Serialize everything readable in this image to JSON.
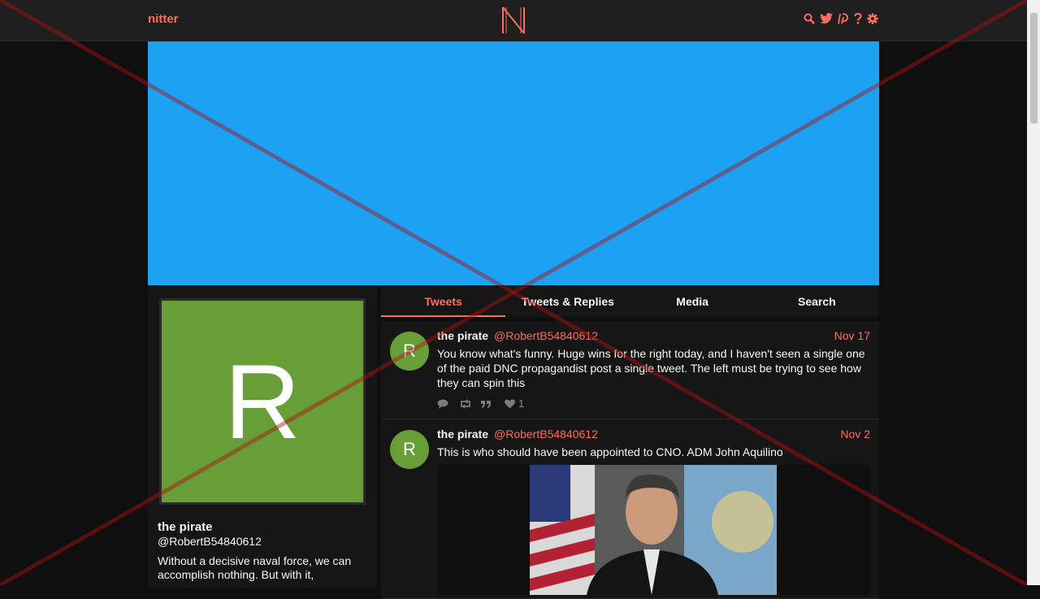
{
  "nav": {
    "brand": "nitter",
    "icons": [
      "search-icon",
      "twitter-icon",
      "rss-icon",
      "help-icon",
      "settings-icon"
    ]
  },
  "colors": {
    "accent": "#ff6c60",
    "banner": "#1da1f2",
    "avatar": "#679e37",
    "background": "#0f0f0f",
    "panel": "#161616"
  },
  "profile": {
    "avatar_letter": "R",
    "fullname": "the pirate",
    "username": "@RobertB54840612",
    "bio": "Without a decisive naval force, we can accomplish nothing. But with it,"
  },
  "tabs": [
    {
      "label": "Tweets",
      "active": true
    },
    {
      "label": "Tweets & Replies",
      "active": false
    },
    {
      "label": "Media",
      "active": false
    },
    {
      "label": "Search",
      "active": false
    }
  ],
  "tweets": [
    {
      "avatar_letter": "R",
      "fullname": "the pirate",
      "username": "@RobertB54840612",
      "date": "Nov 17",
      "text": "You know what's funny. Huge wins for the right today, and I haven't seen a single one of the paid DNC propagandist post a single tweet.  The left must be trying to see how they can spin this",
      "likes": "1"
    },
    {
      "avatar_letter": "R",
      "fullname": "the pirate",
      "username": "@RobertB54840612",
      "date": "Nov 2",
      "text": "This is who should have been appointed to CNO. ADM John Aquilino"
    }
  ]
}
